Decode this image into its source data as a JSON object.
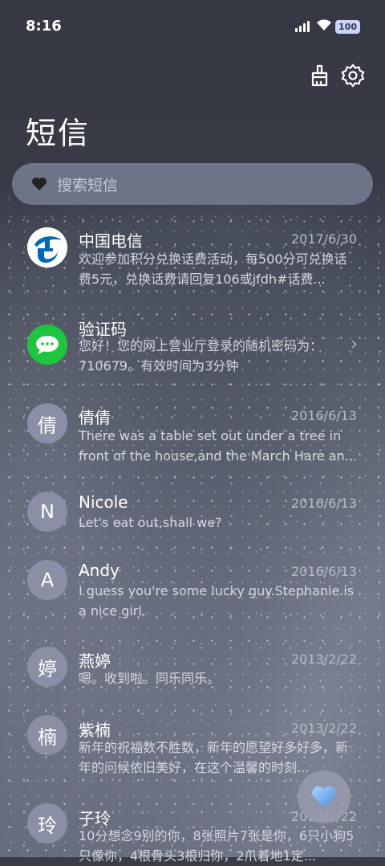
{
  "status": {
    "time": "8:16",
    "battery": "100"
  },
  "header": {
    "title": "短信",
    "clean_icon": "broom-icon",
    "settings_icon": "gear-icon"
  },
  "search": {
    "placeholder": "搜索短信",
    "icon": "heart-icon"
  },
  "messages": [
    {
      "name": "中国电信",
      "date": "2017/6/30",
      "avatar": "",
      "avatar_type": "telecom-logo",
      "preview": "欢迎参加积分兑换话费活动，每500分可兑换话费5元，兑换话费请回复106或jfdh#话费..."
    },
    {
      "name": "验证码",
      "date": "",
      "avatar": "",
      "avatar_type": "message-logo",
      "preview": "您好！您的网上营业厅登录的随机密码为：710679。有效时间为3分钟"
    },
    {
      "name": "倩倩",
      "date": "2016/6/13",
      "avatar": "倩",
      "preview": "There was a table set out under a tree in front of the house,and the March Hare an..."
    },
    {
      "name": "Nicole",
      "date": "2016/6/13",
      "avatar": "N",
      "preview": "Let's eat out,shall we?"
    },
    {
      "name": "Andy",
      "date": "2016/6/13",
      "avatar": "A",
      "preview": "I guess you're some lucky guy.Stephanie is a nice girl."
    },
    {
      "name": "燕婷",
      "date": "2013/2/22",
      "avatar": "婷",
      "preview": "嗯。收到啦。同乐同乐。"
    },
    {
      "name": "紫楠",
      "date": "2013/2/22",
      "avatar": "楠",
      "preview": "新年的祝福数不胜数，新年的愿望好多好多，新年的问候依旧美好，在这个温馨的时刻..."
    },
    {
      "name": "子玲",
      "date": "2013/2/22",
      "avatar": "玲",
      "preview": "10分想念9别的你，8张照片7张是你，6只小狗5只像你，4根骨头3根归你，2爪着地1定..."
    }
  ],
  "fab": {
    "icon": "heart-icon"
  },
  "colors": {
    "accent_blue": "#0068b7",
    "wechat_green": "#1ec53f",
    "avatar_gray": "#8a8fa6"
  }
}
